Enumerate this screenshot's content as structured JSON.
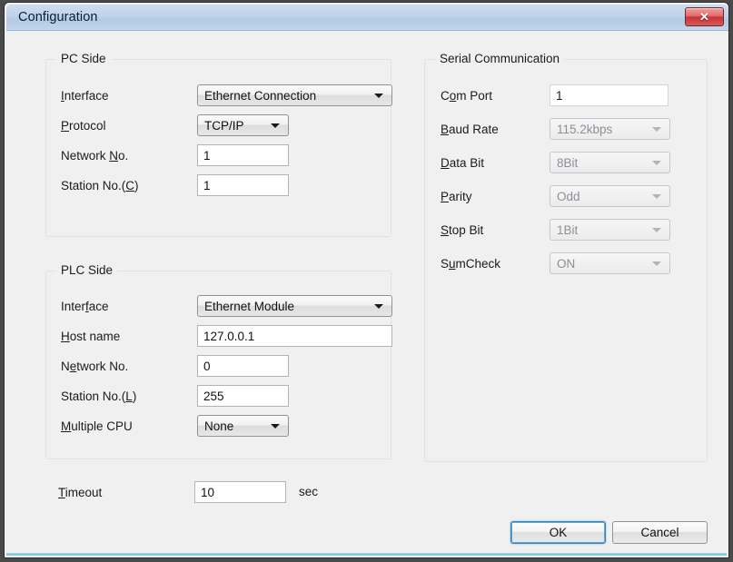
{
  "window": {
    "title": "Configuration",
    "close_label": "✕"
  },
  "groups": {
    "pc_side": {
      "title": "PC Side",
      "fields": {
        "interface": {
          "label_pre": "",
          "label_accel": "I",
          "label_post": "nterface",
          "value": "Ethernet Connection",
          "type": "combo",
          "enabled": true
        },
        "protocol": {
          "label_pre": "",
          "label_accel": "P",
          "label_post": "rotocol",
          "value": "TCP/IP",
          "type": "combo",
          "enabled": true
        },
        "network_no": {
          "label_pre": "Network ",
          "label_accel": "N",
          "label_post": "o.",
          "value": "1",
          "type": "text",
          "enabled": true
        },
        "station_no": {
          "label_pre": "Station No.(",
          "label_accel": "C",
          "label_post": ")",
          "value": "1",
          "type": "text",
          "enabled": true
        }
      }
    },
    "plc_side": {
      "title": "PLC Side",
      "fields": {
        "interface": {
          "label_pre": "Inter",
          "label_accel": "f",
          "label_post": "ace",
          "value": "Ethernet Module",
          "type": "combo",
          "enabled": true
        },
        "host_name": {
          "label_pre": "",
          "label_accel": "H",
          "label_post": "ost name",
          "value": "127.0.0.1",
          "type": "text",
          "enabled": true
        },
        "network_no": {
          "label_pre": "N",
          "label_accel": "e",
          "label_post": "twork No.",
          "value": "0",
          "type": "text",
          "enabled": true
        },
        "station_no": {
          "label_pre": "Station No.(",
          "label_accel": "L",
          "label_post": ")",
          "value": "255",
          "type": "text",
          "enabled": true
        },
        "multiple_cpu": {
          "label_pre": "",
          "label_accel": "M",
          "label_post": "ultiple CPU",
          "value": "None",
          "type": "combo",
          "enabled": true
        }
      }
    },
    "serial": {
      "title": "Serial Communication",
      "fields": {
        "com_port": {
          "label_pre": "C",
          "label_accel": "o",
          "label_post": "m Port",
          "value": "1",
          "type": "text",
          "enabled": false
        },
        "baud_rate": {
          "label_pre": "",
          "label_accel": "B",
          "label_post": "aud Rate",
          "value": "115.2kbps",
          "type": "combo",
          "enabled": false
        },
        "data_bit": {
          "label_pre": "",
          "label_accel": "D",
          "label_post": "ata Bit",
          "value": "8Bit",
          "type": "combo",
          "enabled": false
        },
        "parity": {
          "label_pre": "",
          "label_accel": "P",
          "label_post": "arity",
          "value": "Odd",
          "type": "combo",
          "enabled": false
        },
        "stop_bit": {
          "label_pre": "",
          "label_accel": "S",
          "label_post": "top Bit",
          "value": "1Bit",
          "type": "combo",
          "enabled": false
        },
        "sum_check": {
          "label_pre": "S",
          "label_accel": "u",
          "label_post": "mCheck",
          "value": "ON",
          "type": "combo",
          "enabled": false
        }
      }
    }
  },
  "timeout": {
    "label_pre": "",
    "label_accel": "T",
    "label_post": "imeout",
    "value": "10",
    "unit": "sec"
  },
  "buttons": {
    "ok": "OK",
    "cancel": "Cancel"
  },
  "colors": {
    "titlebar": "#bfd3ea",
    "client_bg": "#eff0ef",
    "close_button": "#c63434",
    "default_button_focus": "#3c7fb1",
    "disabled_text": "#8b9097",
    "groupbox_border": "#dfe3e6"
  }
}
